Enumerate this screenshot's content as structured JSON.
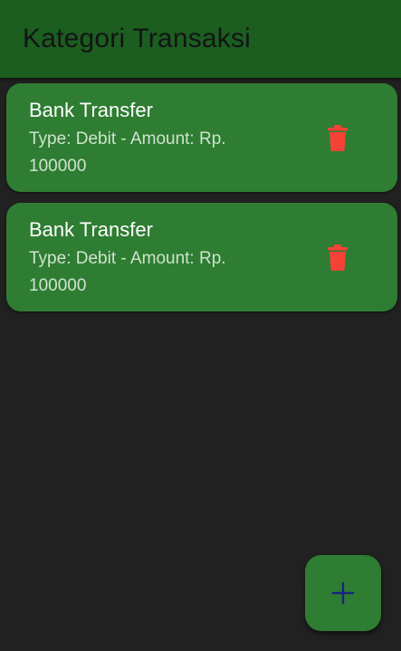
{
  "appbar": {
    "title": "Kategori Transaksi"
  },
  "transactions": [
    {
      "title": "Bank Transfer",
      "subtitle": "Type: Debit - Amount: Rp. 100000",
      "action_icon": "delete-icon"
    },
    {
      "title": "Bank Transfer",
      "subtitle": "Type: Debit - Amount: Rp. 100000",
      "action_icon": "delete-icon"
    }
  ],
  "fab": {
    "icon": "add-icon"
  },
  "colors": {
    "background": "#212121",
    "appbar": "#1b5e20",
    "card": "#2e7d32",
    "delete": "#f44336",
    "fab_icon": "#1a237e"
  }
}
